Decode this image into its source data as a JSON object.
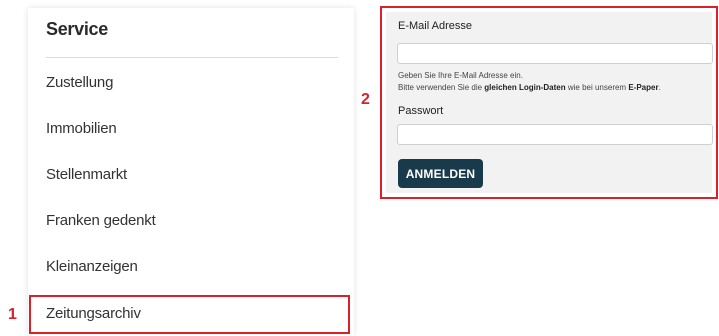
{
  "service_menu": {
    "title": "Service",
    "items": [
      {
        "label": "Zustellung"
      },
      {
        "label": "Immobilien"
      },
      {
        "label": "Stellenmarkt"
      },
      {
        "label": "Franken gedenkt"
      },
      {
        "label": "Kleinanzeigen"
      },
      {
        "label": "Zeitungsarchiv"
      }
    ]
  },
  "annotations": {
    "marker_1": "1",
    "marker_2": "2",
    "highlight_color": "#d8222a"
  },
  "login_form": {
    "email_label": "E-Mail Adresse",
    "email_value": "",
    "hint_line1": "Geben Sie Ihre E-Mail Adresse ein.",
    "hint_line2_pre": "Bitte verwenden Sie die ",
    "hint_line2_bold1": "gleichen Login-Daten",
    "hint_line2_mid": " wie bei unserem ",
    "hint_line2_bold2": "E-Paper",
    "hint_line2_post": ".",
    "password_label": "Passwort",
    "password_value": "",
    "submit_label": "ANMELDEN",
    "button_color": "#183a4a"
  }
}
